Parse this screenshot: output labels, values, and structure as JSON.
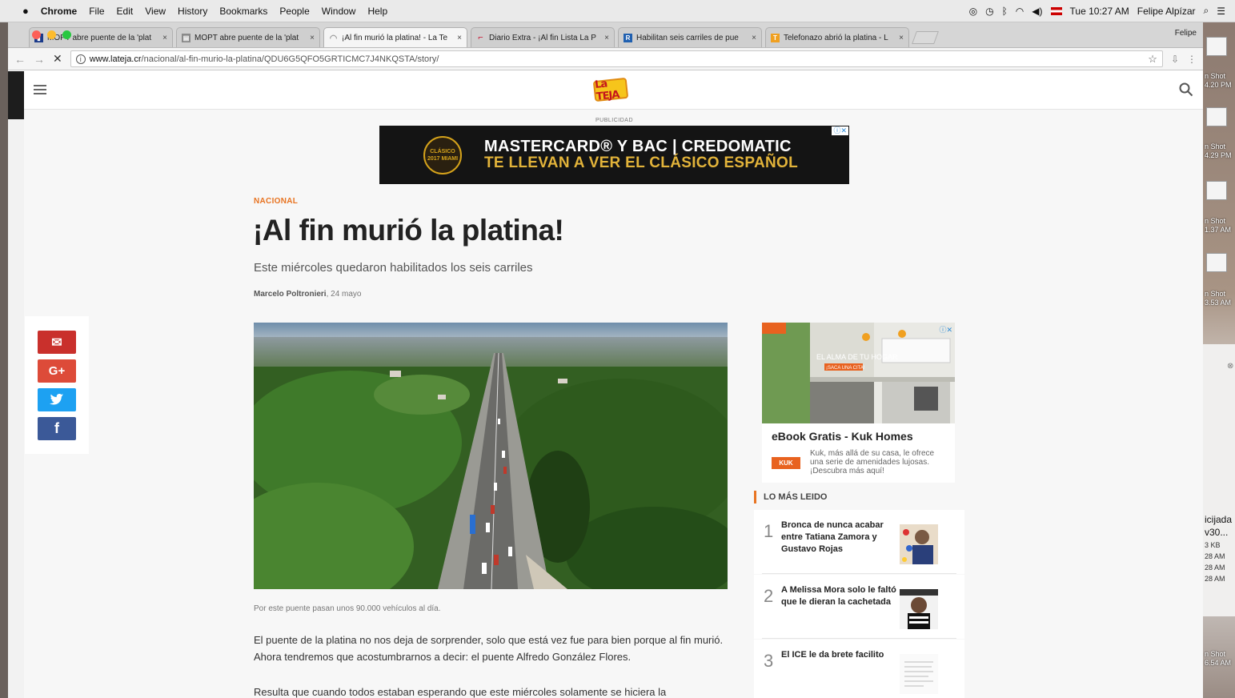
{
  "menubar": {
    "app": "Chrome",
    "items": [
      "File",
      "Edit",
      "View",
      "History",
      "Bookmarks",
      "People",
      "Window",
      "Help"
    ],
    "clock": "Tue 10:27 AM",
    "user": "Felipe Alpízar"
  },
  "browser": {
    "tabs": [
      {
        "label": "MOPT abre puente de la 'plat",
        "icon": "page-icon",
        "color": "#1a3a8a"
      },
      {
        "label": "MOPT abre puente de la 'plat",
        "icon": "page-icon",
        "color": "#8a8a8a"
      },
      {
        "label": "¡Al fin murió la platina! - La Te",
        "icon": "loading-icon",
        "color": "#999999",
        "active": true
      },
      {
        "label": "Diario Extra - ¡Al fin Lista La P",
        "icon": "extra-icon",
        "color": "#c8102e"
      },
      {
        "label": "Habilitan seis carriles de pue",
        "icon": "r-icon",
        "color": "#2060b0"
      },
      {
        "label": "Telefonazo abrió la platina - L",
        "icon": "orange-icon",
        "color": "#f0a020"
      }
    ],
    "profile": "Felipe",
    "url_host": "www.lateja.cr",
    "url_path": "/nacional/al-fin-murio-la-platina/QDU6G5QFO5GRTICMC7J4NKQSTA/story/"
  },
  "site": {
    "ad_label": "PUBLICIDAD",
    "banner": {
      "line1": "MASTERCARD® Y BAC | CREDOMATIC",
      "line2": "TE LLEVAN A VER EL CLÁSICO ESPAÑOL",
      "badge": "CLÁSICO 2017 MIAMI"
    },
    "section": "NACIONAL",
    "title": "¡Al fin murió la platina!",
    "subtitle": "Este miércoles quedaron habilitados los seis carriles",
    "author": "Marcelo Poltronieri",
    "date": ", 24 mayo",
    "caption": "Por este puente pasan unos 90.000 vehículos al día.",
    "paragraph1": "El puente de la platina no nos deja de sorprender, solo que está vez fue para bien porque al fin murió. Ahora tendremos que acostumbrarnos a decir: el puente Alfredo González Flores.",
    "paragraph2": "Resulta que cuando todos estaban esperando que este miércoles solamente se hiciera la",
    "share": [
      {
        "icon": "email-icon",
        "glyph": "✉",
        "color": "#c9302c"
      },
      {
        "icon": "google-plus-icon",
        "glyph": "G+",
        "color": "#dd4b39"
      },
      {
        "icon": "twitter-icon",
        "glyph": "🐦",
        "color": "#1da1f2"
      },
      {
        "icon": "facebook-icon",
        "glyph": "f",
        "color": "#3b5998"
      }
    ],
    "ad": {
      "title": "eBook Gratis - Kuk Homes",
      "text": "Kuk, más allá de su casa, le ofrece una serie de amenidades lujosas. ¡Descubra más aquí!",
      "logo": "KUK",
      "image_text": "EL ALMA DE TU HOGAR",
      "image_cta": "¡SACA UNA CITA!"
    },
    "most_read": {
      "header": "LO MÁS LEIDO",
      "items": [
        {
          "num": "1",
          "title": "Bronca de nunca acabar entre Tatiana Zamora y Gustavo Rojas"
        },
        {
          "num": "2",
          "title": "A Melissa Mora solo le faltó que le dieran la cachetada"
        },
        {
          "num": "3",
          "title": "El ICE le da brete facilito"
        }
      ]
    }
  },
  "desktop": {
    "files": [
      {
        "label": "n Shot",
        "sub": "4.20 PM"
      },
      {
        "label": "n Shot",
        "sub": "4.29 PM"
      },
      {
        "label": "n Shot",
        "sub": "1.37 AM"
      },
      {
        "label": "n Shot",
        "sub": "3.53 AM"
      },
      {
        "label": "n Shot",
        "sub": "6.54 AM"
      }
    ],
    "panel_title": "icijada",
    "panel_sub": "v30...",
    "panel_size": "3 KB",
    "panel_times": [
      "28 AM",
      "28 AM",
      "28 AM"
    ]
  }
}
